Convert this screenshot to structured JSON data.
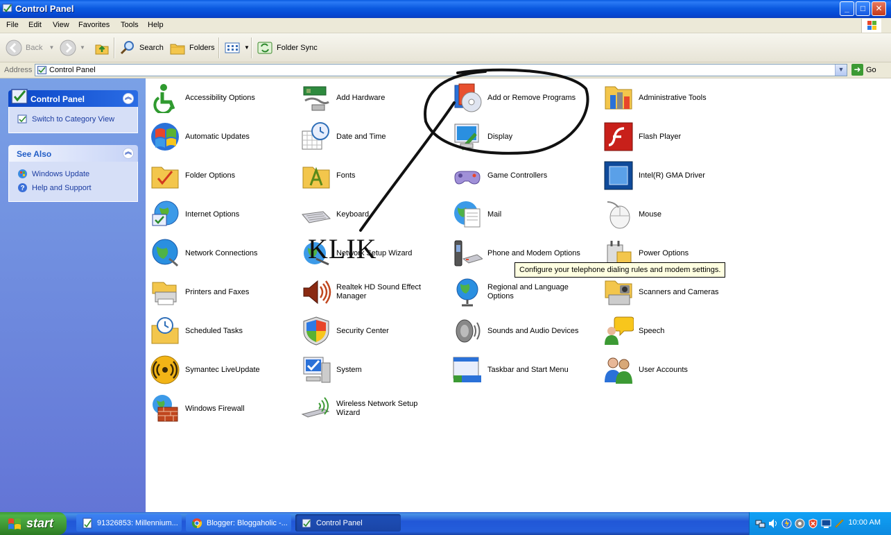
{
  "window": {
    "title": "Control Panel",
    "minimize": "_",
    "maximize": "□",
    "close": "✕"
  },
  "menu": [
    "File",
    "Edit",
    "View",
    "Favorites",
    "Tools",
    "Help"
  ],
  "toolbar": {
    "back": "Back",
    "search": "Search",
    "folders": "Folders",
    "folder_sync": "Folder Sync"
  },
  "address": {
    "label": "Address",
    "value": "Control Panel",
    "go": "Go"
  },
  "taskpane": {
    "panel1": {
      "title": "Control Panel",
      "link": "Switch to Category View"
    },
    "panel2": {
      "title": "See Also",
      "links": [
        "Windows Update",
        "Help and Support"
      ]
    }
  },
  "items": [
    [
      "Accessibility Options",
      "Add Hardware",
      "Add or Remove Programs",
      "Administrative Tools"
    ],
    [
      "Automatic Updates",
      "Date and Time",
      "Display",
      "Flash Player"
    ],
    [
      "Folder Options",
      "Fonts",
      "Game Controllers",
      "Intel(R) GMA Driver"
    ],
    [
      "Internet Options",
      "Keyboard",
      "Mail",
      "Mouse"
    ],
    [
      "Network Connections",
      "Network Setup Wizard",
      "Phone and Modem Options",
      "Power Options"
    ],
    [
      "Printers and Faxes",
      "Realtek HD Sound Effect Manager",
      "Regional and Language Options",
      "Scanners and Cameras"
    ],
    [
      "Scheduled Tasks",
      "Security Center",
      "Sounds and Audio Devices",
      "Speech"
    ],
    [
      "Symantec LiveUpdate",
      "System",
      "Taskbar and Start Menu",
      "User Accounts"
    ],
    [
      "Windows Firewall",
      "Wireless Network Setup Wizard"
    ]
  ],
  "tooltip": "Configure your telephone dialing rules and modem settings.",
  "annotation": {
    "text": "KLIK"
  },
  "taskbar": {
    "start": "start",
    "tasks": [
      "91326853: Millennium...",
      "Blogger: Bloggaholic -...",
      "Control Panel"
    ],
    "clock": "10:00 AM"
  },
  "colors": {
    "titlebar": "#0a5be0",
    "taskpane": "#7aa1e6",
    "start": "#3c9a34",
    "tooltip_bg": "#ffffe1"
  }
}
